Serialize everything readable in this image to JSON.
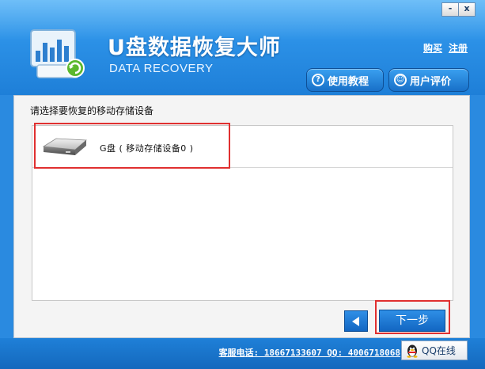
{
  "window": {
    "controls": {
      "minimize": "-",
      "close": "x"
    }
  },
  "header": {
    "app_title": "U盘数据恢复大师",
    "app_subtitle": "DATA RECOVERY",
    "links": {
      "buy": "购买",
      "register": "注册"
    },
    "buttons": {
      "tutorial": {
        "icon": "question-circle-icon",
        "glyph": "?",
        "label": "使用教程"
      },
      "review": {
        "icon": "smile-circle-icon",
        "glyph": "☺",
        "label": "用户评价"
      }
    }
  },
  "main": {
    "prompt": "请选择要恢复的移动存储设备",
    "devices": [
      {
        "icon": "drive-icon",
        "label": "G盘 ( 移动存储设备0 )"
      }
    ]
  },
  "nav": {
    "back": {
      "icon": "left-arrow-icon"
    },
    "next_label": "下一步"
  },
  "footer": {
    "contact": "客服电话: 18667133607 QQ: 4006718068",
    "qq_button": {
      "icon": "qq-penguin-icon",
      "label": "QQ在线"
    }
  },
  "colors": {
    "header_top": "#4fb0f6",
    "header_bottom": "#1e7fd8",
    "button_blue": "#1870c8",
    "highlight_red": "#e03030",
    "panel_bg": "#f4f4f4"
  }
}
